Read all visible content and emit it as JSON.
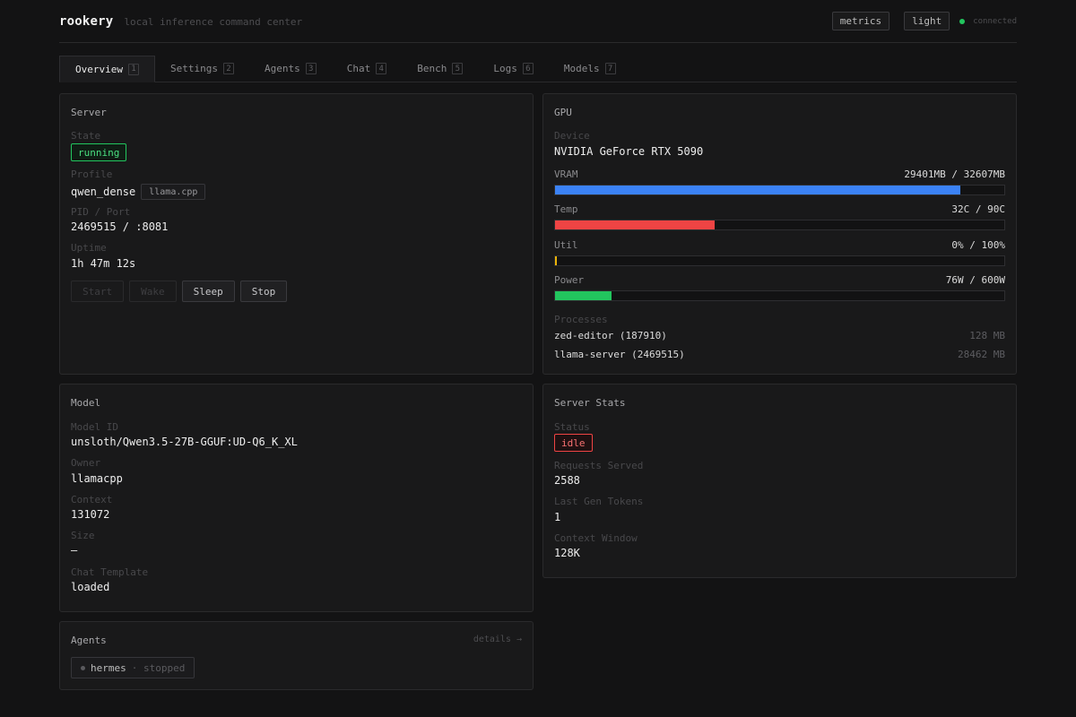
{
  "header": {
    "brand": "rookery",
    "tagline": "local inference command center",
    "metrics_label": "metrics",
    "theme_label": "light",
    "connection_status": "connected",
    "connection_color": "#22c55e"
  },
  "tabs": [
    {
      "label": "Overview",
      "key": "1",
      "active": true
    },
    {
      "label": "Settings",
      "key": "2"
    },
    {
      "label": "Agents",
      "key": "3"
    },
    {
      "label": "Chat",
      "key": "4"
    },
    {
      "label": "Bench",
      "key": "5"
    },
    {
      "label": "Logs",
      "key": "6"
    },
    {
      "label": "Models",
      "key": "7"
    }
  ],
  "server": {
    "title": "Server",
    "state_label": "State",
    "state": "running",
    "profile_label": "Profile",
    "profile": "qwen_dense",
    "engine": "llama.cpp",
    "pid_label": "PID / Port",
    "pid_port": "2469515 / :8081",
    "uptime_label": "Uptime",
    "uptime": "1h 47m 12s",
    "buttons": {
      "start": "Start",
      "wake": "Wake",
      "sleep": "Sleep",
      "stop": "Stop"
    }
  },
  "gpu": {
    "title": "GPU",
    "device_label": "Device",
    "device": "NVIDIA GeForce RTX 5090",
    "vram_label": "VRAM",
    "vram": "29401MB / 32607MB",
    "vram_fraction": 0.9017,
    "temp_label": "Temp",
    "temp": "32C / 90C",
    "temp_fraction": 0.3556,
    "util_label": "Util",
    "util": "0% / 100%",
    "util_fraction": 0.0,
    "power_label": "Power",
    "power": "76W / 600W",
    "power_fraction": 0.1267,
    "colors": {
      "vram": "#3b82f6",
      "temp": "#ef4444",
      "util": "#eab308",
      "power": "#22c55e"
    },
    "processes_label": "Processes",
    "processes": [
      {
        "name": "zed-editor (187910)",
        "mem": "128 MB"
      },
      {
        "name": "llama-server (2469515)",
        "mem": "28462 MB"
      }
    ]
  },
  "model": {
    "title": "Model",
    "id_label": "Model ID",
    "id": "unsloth/Qwen3.5-27B-GGUF:UD-Q6_K_XL",
    "owner_label": "Owner",
    "owner": "llamacpp",
    "context_label": "Context",
    "context": "131072",
    "size_label": "Size",
    "size": "—",
    "template_label": "Chat Template",
    "template": "loaded"
  },
  "stats": {
    "title": "Server Stats",
    "status_label": "Status",
    "status": "idle",
    "requests_label": "Requests Served",
    "requests": "2588",
    "last_gen_label": "Last Gen Tokens",
    "last_gen": "1",
    "ctx_window_label": "Context Window",
    "ctx_window": "128K"
  },
  "agents": {
    "title": "Agents",
    "details": "details →",
    "items": [
      {
        "name": "hermes",
        "state": "· stopped"
      }
    ]
  }
}
